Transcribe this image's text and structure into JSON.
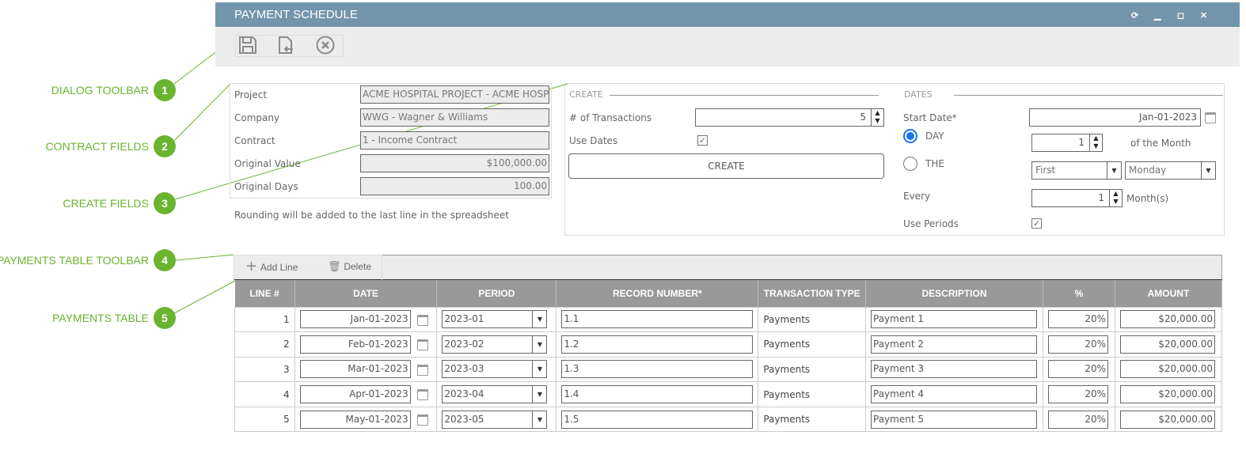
{
  "callouts": [
    {
      "num": "1",
      "label": "DIALOG TOOLBAR"
    },
    {
      "num": "2",
      "label": "CONTRACT FIELDS"
    },
    {
      "num": "3",
      "label": "CREATE FIELDS"
    },
    {
      "num": "4",
      "label": "PAYMENTS TABLE TOOLBAR"
    },
    {
      "num": "5",
      "label": "PAYMENTS TABLE"
    }
  ],
  "colors": {
    "accent": "#6ab42f",
    "titlebar": "#7395ab",
    "header": "#999999",
    "radio": "#1a73e8"
  },
  "window": {
    "title": "PAYMENT SCHEDULE",
    "controls": [
      "refresh-icon",
      "minimize-icon",
      "maximize-icon",
      "close-icon"
    ]
  },
  "toolbar": {
    "icons": [
      "save-icon",
      "import-icon",
      "cancel-icon"
    ]
  },
  "contract": {
    "fields": [
      {
        "label": "Project",
        "value": "ACME HOSPITAL PROJECT - ACME HOSP"
      },
      {
        "label": "Company",
        "value": "WWG - Wagner & Williams"
      },
      {
        "label": "Contract",
        "value": "1 - Income Contract"
      },
      {
        "label": "Original Value",
        "value": "$100,000.00"
      },
      {
        "label": "Original Days",
        "value": "100.00"
      }
    ],
    "note": "Rounding will be added to the last line in the spreadsheet"
  },
  "create": {
    "legend": "CREATE",
    "transactions_label": "# of Transactions",
    "transactions_value": "5",
    "use_dates_label": "Use Dates",
    "use_dates_checked": true,
    "create_button": "CREATE"
  },
  "dates": {
    "legend": "DATES",
    "start_date_label": "Start Date*",
    "start_date_value": "Jan-01-2023",
    "day_label": "DAY",
    "day_selected": true,
    "day_value": "1",
    "of_month": "of the Month",
    "the_label": "THE",
    "the_selected": false,
    "ordinal": "First",
    "weekday": "Monday",
    "every_label": "Every",
    "every_value": "1",
    "every_unit": "Month(s)",
    "use_periods_label": "Use Periods",
    "use_periods_checked": true
  },
  "table_toolbar": {
    "add": "Add Line",
    "delete": "Delete"
  },
  "table": {
    "columns": [
      "LINE #",
      "DATE",
      "PERIOD",
      "RECORD NUMBER*",
      "TRANSACTION TYPE",
      "DESCRIPTION",
      "%",
      "AMOUNT"
    ],
    "rows": [
      {
        "line": "1",
        "date": "Jan-01-2023",
        "period": "2023-01",
        "record": "1.1",
        "type": "Payments",
        "desc": "Payment 1",
        "pct": "20%",
        "amount": "$20,000.00"
      },
      {
        "line": "2",
        "date": "Feb-01-2023",
        "period": "2023-02",
        "record": "1.2",
        "type": "Payments",
        "desc": "Payment 2",
        "pct": "20%",
        "amount": "$20,000.00"
      },
      {
        "line": "3",
        "date": "Mar-01-2023",
        "period": "2023-03",
        "record": "1.3",
        "type": "Payments",
        "desc": "Payment 3",
        "pct": "20%",
        "amount": "$20,000.00"
      },
      {
        "line": "4",
        "date": "Apr-01-2023",
        "period": "2023-04",
        "record": "1.4",
        "type": "Payments",
        "desc": "Payment 4",
        "pct": "20%",
        "amount": "$20,000.00"
      },
      {
        "line": "5",
        "date": "May-01-2023",
        "period": "2023-05",
        "record": "1.5",
        "type": "Payments",
        "desc": "Payment 5",
        "pct": "20%",
        "amount": "$20,000.00"
      }
    ]
  }
}
